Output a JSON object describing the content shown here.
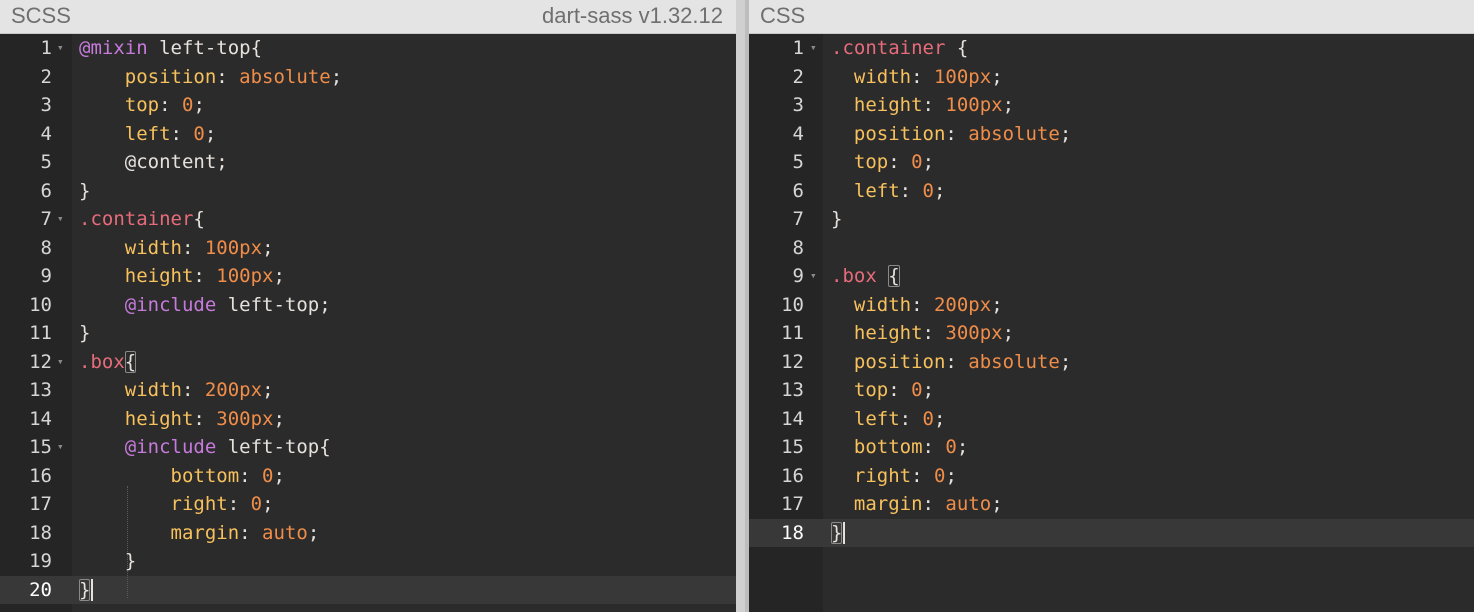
{
  "left_pane": {
    "title": "SCSS",
    "version": "dart-sass v1.32.12",
    "lines": [
      {
        "n": "1",
        "fold": true,
        "tokens": [
          [
            "kw",
            "@mixin"
          ],
          [
            "pl",
            " left-top{"
          ]
        ]
      },
      {
        "n": "2",
        "fold": false,
        "tokens": [
          [
            "pl",
            "    "
          ],
          [
            "prop",
            "position"
          ],
          [
            "pl",
            ": "
          ],
          [
            "val",
            "absolute"
          ],
          [
            "pl",
            ";"
          ]
        ]
      },
      {
        "n": "3",
        "fold": false,
        "tokens": [
          [
            "pl",
            "    "
          ],
          [
            "prop",
            "top"
          ],
          [
            "pl",
            ": "
          ],
          [
            "val",
            "0"
          ],
          [
            "pl",
            ";"
          ]
        ]
      },
      {
        "n": "4",
        "fold": false,
        "tokens": [
          [
            "pl",
            "    "
          ],
          [
            "prop",
            "left"
          ],
          [
            "pl",
            ": "
          ],
          [
            "val",
            "0"
          ],
          [
            "pl",
            ";"
          ]
        ]
      },
      {
        "n": "5",
        "fold": false,
        "tokens": [
          [
            "pl",
            "    @content;"
          ]
        ]
      },
      {
        "n": "6",
        "fold": false,
        "tokens": [
          [
            "pl",
            "}"
          ]
        ]
      },
      {
        "n": "7",
        "fold": true,
        "tokens": [
          [
            "sel",
            ".container"
          ],
          [
            "pl",
            "{"
          ]
        ]
      },
      {
        "n": "8",
        "fold": false,
        "tokens": [
          [
            "pl",
            "    "
          ],
          [
            "prop",
            "width"
          ],
          [
            "pl",
            ": "
          ],
          [
            "val",
            "100px"
          ],
          [
            "pl",
            ";"
          ]
        ]
      },
      {
        "n": "9",
        "fold": false,
        "tokens": [
          [
            "pl",
            "    "
          ],
          [
            "prop",
            "height"
          ],
          [
            "pl",
            ": "
          ],
          [
            "val",
            "100px"
          ],
          [
            "pl",
            ";"
          ]
        ]
      },
      {
        "n": "10",
        "fold": false,
        "tokens": [
          [
            "pl",
            "    "
          ],
          [
            "kw",
            "@include"
          ],
          [
            "pl",
            " left-top;"
          ]
        ]
      },
      {
        "n": "11",
        "fold": false,
        "tokens": [
          [
            "pl",
            "}"
          ]
        ]
      },
      {
        "n": "12",
        "fold": true,
        "tokens": [
          [
            "sel",
            ".box"
          ],
          [
            "box",
            "{"
          ]
        ]
      },
      {
        "n": "13",
        "fold": false,
        "tokens": [
          [
            "pl",
            "    "
          ],
          [
            "prop",
            "width"
          ],
          [
            "pl",
            ": "
          ],
          [
            "val",
            "200px"
          ],
          [
            "pl",
            ";"
          ]
        ]
      },
      {
        "n": "14",
        "fold": false,
        "tokens": [
          [
            "pl",
            "    "
          ],
          [
            "prop",
            "height"
          ],
          [
            "pl",
            ": "
          ],
          [
            "val",
            "300px"
          ],
          [
            "pl",
            ";"
          ]
        ]
      },
      {
        "n": "15",
        "fold": true,
        "tokens": [
          [
            "pl",
            "    "
          ],
          [
            "kw",
            "@include"
          ],
          [
            "pl",
            " left-top{"
          ]
        ]
      },
      {
        "n": "16",
        "fold": false,
        "tokens": [
          [
            "pl",
            "        "
          ],
          [
            "prop",
            "bottom"
          ],
          [
            "pl",
            ": "
          ],
          [
            "val",
            "0"
          ],
          [
            "pl",
            ";"
          ]
        ]
      },
      {
        "n": "17",
        "fold": false,
        "tokens": [
          [
            "pl",
            "        "
          ],
          [
            "prop",
            "right"
          ],
          [
            "pl",
            ": "
          ],
          [
            "val",
            "0"
          ],
          [
            "pl",
            ";"
          ]
        ]
      },
      {
        "n": "18",
        "fold": false,
        "tokens": [
          [
            "pl",
            "        "
          ],
          [
            "prop",
            "margin"
          ],
          [
            "pl",
            ": "
          ],
          [
            "val",
            "auto"
          ],
          [
            "pl",
            ";"
          ]
        ]
      },
      {
        "n": "19",
        "fold": false,
        "tokens": [
          [
            "pl",
            "    }"
          ]
        ]
      },
      {
        "n": "20",
        "fold": false,
        "active": true,
        "tokens": [
          [
            "box",
            "}"
          ],
          [
            "cursor",
            ""
          ]
        ]
      }
    ]
  },
  "right_pane": {
    "title": "CSS",
    "lines": [
      {
        "n": "1",
        "fold": true,
        "tokens": [
          [
            "sel",
            ".container"
          ],
          [
            "pl",
            " {"
          ]
        ]
      },
      {
        "n": "2",
        "fold": false,
        "tokens": [
          [
            "pl",
            "  "
          ],
          [
            "prop",
            "width"
          ],
          [
            "pl",
            ": "
          ],
          [
            "val",
            "100px"
          ],
          [
            "pl",
            ";"
          ]
        ]
      },
      {
        "n": "3",
        "fold": false,
        "tokens": [
          [
            "pl",
            "  "
          ],
          [
            "prop",
            "height"
          ],
          [
            "pl",
            ": "
          ],
          [
            "val",
            "100px"
          ],
          [
            "pl",
            ";"
          ]
        ]
      },
      {
        "n": "4",
        "fold": false,
        "tokens": [
          [
            "pl",
            "  "
          ],
          [
            "prop",
            "position"
          ],
          [
            "pl",
            ": "
          ],
          [
            "val",
            "absolute"
          ],
          [
            "pl",
            ";"
          ]
        ]
      },
      {
        "n": "5",
        "fold": false,
        "tokens": [
          [
            "pl",
            "  "
          ],
          [
            "prop",
            "top"
          ],
          [
            "pl",
            ": "
          ],
          [
            "val",
            "0"
          ],
          [
            "pl",
            ";"
          ]
        ]
      },
      {
        "n": "6",
        "fold": false,
        "tokens": [
          [
            "pl",
            "  "
          ],
          [
            "prop",
            "left"
          ],
          [
            "pl",
            ": "
          ],
          [
            "val",
            "0"
          ],
          [
            "pl",
            ";"
          ]
        ]
      },
      {
        "n": "7",
        "fold": false,
        "tokens": [
          [
            "pl",
            "}"
          ]
        ]
      },
      {
        "n": "8",
        "fold": false,
        "tokens": []
      },
      {
        "n": "9",
        "fold": true,
        "tokens": [
          [
            "sel",
            ".box"
          ],
          [
            "pl",
            " "
          ],
          [
            "box",
            "{"
          ]
        ]
      },
      {
        "n": "10",
        "fold": false,
        "tokens": [
          [
            "pl",
            "  "
          ],
          [
            "prop",
            "width"
          ],
          [
            "pl",
            ": "
          ],
          [
            "val",
            "200px"
          ],
          [
            "pl",
            ";"
          ]
        ]
      },
      {
        "n": "11",
        "fold": false,
        "tokens": [
          [
            "pl",
            "  "
          ],
          [
            "prop",
            "height"
          ],
          [
            "pl",
            ": "
          ],
          [
            "val",
            "300px"
          ],
          [
            "pl",
            ";"
          ]
        ]
      },
      {
        "n": "12",
        "fold": false,
        "tokens": [
          [
            "pl",
            "  "
          ],
          [
            "prop",
            "position"
          ],
          [
            "pl",
            ": "
          ],
          [
            "val",
            "absolute"
          ],
          [
            "pl",
            ";"
          ]
        ]
      },
      {
        "n": "13",
        "fold": false,
        "tokens": [
          [
            "pl",
            "  "
          ],
          [
            "prop",
            "top"
          ],
          [
            "pl",
            ": "
          ],
          [
            "val",
            "0"
          ],
          [
            "pl",
            ";"
          ]
        ]
      },
      {
        "n": "14",
        "fold": false,
        "tokens": [
          [
            "pl",
            "  "
          ],
          [
            "prop",
            "left"
          ],
          [
            "pl",
            ": "
          ],
          [
            "val",
            "0"
          ],
          [
            "pl",
            ";"
          ]
        ]
      },
      {
        "n": "15",
        "fold": false,
        "tokens": [
          [
            "pl",
            "  "
          ],
          [
            "prop",
            "bottom"
          ],
          [
            "pl",
            ": "
          ],
          [
            "val",
            "0"
          ],
          [
            "pl",
            ";"
          ]
        ]
      },
      {
        "n": "16",
        "fold": false,
        "tokens": [
          [
            "pl",
            "  "
          ],
          [
            "prop",
            "right"
          ],
          [
            "pl",
            ": "
          ],
          [
            "val",
            "0"
          ],
          [
            "pl",
            ";"
          ]
        ]
      },
      {
        "n": "17",
        "fold": false,
        "tokens": [
          [
            "pl",
            "  "
          ],
          [
            "prop",
            "margin"
          ],
          [
            "pl",
            ": "
          ],
          [
            "val",
            "auto"
          ],
          [
            "pl",
            ";"
          ]
        ]
      },
      {
        "n": "18",
        "fold": false,
        "active": true,
        "tokens": [
          [
            "box",
            "}"
          ],
          [
            "cursor",
            ""
          ]
        ]
      }
    ]
  },
  "colors": {
    "keyword": "#c67bdc",
    "selector": "#e66c7b",
    "property": "#f7c15d",
    "value": "#f08d49",
    "plain": "#e6e1dc",
    "editor_bg": "#2b2b2b",
    "gutter_bg": "#252525"
  },
  "icons": {
    "fold_marker": "chevron-down-icon",
    "fold_glyph": "▾"
  }
}
